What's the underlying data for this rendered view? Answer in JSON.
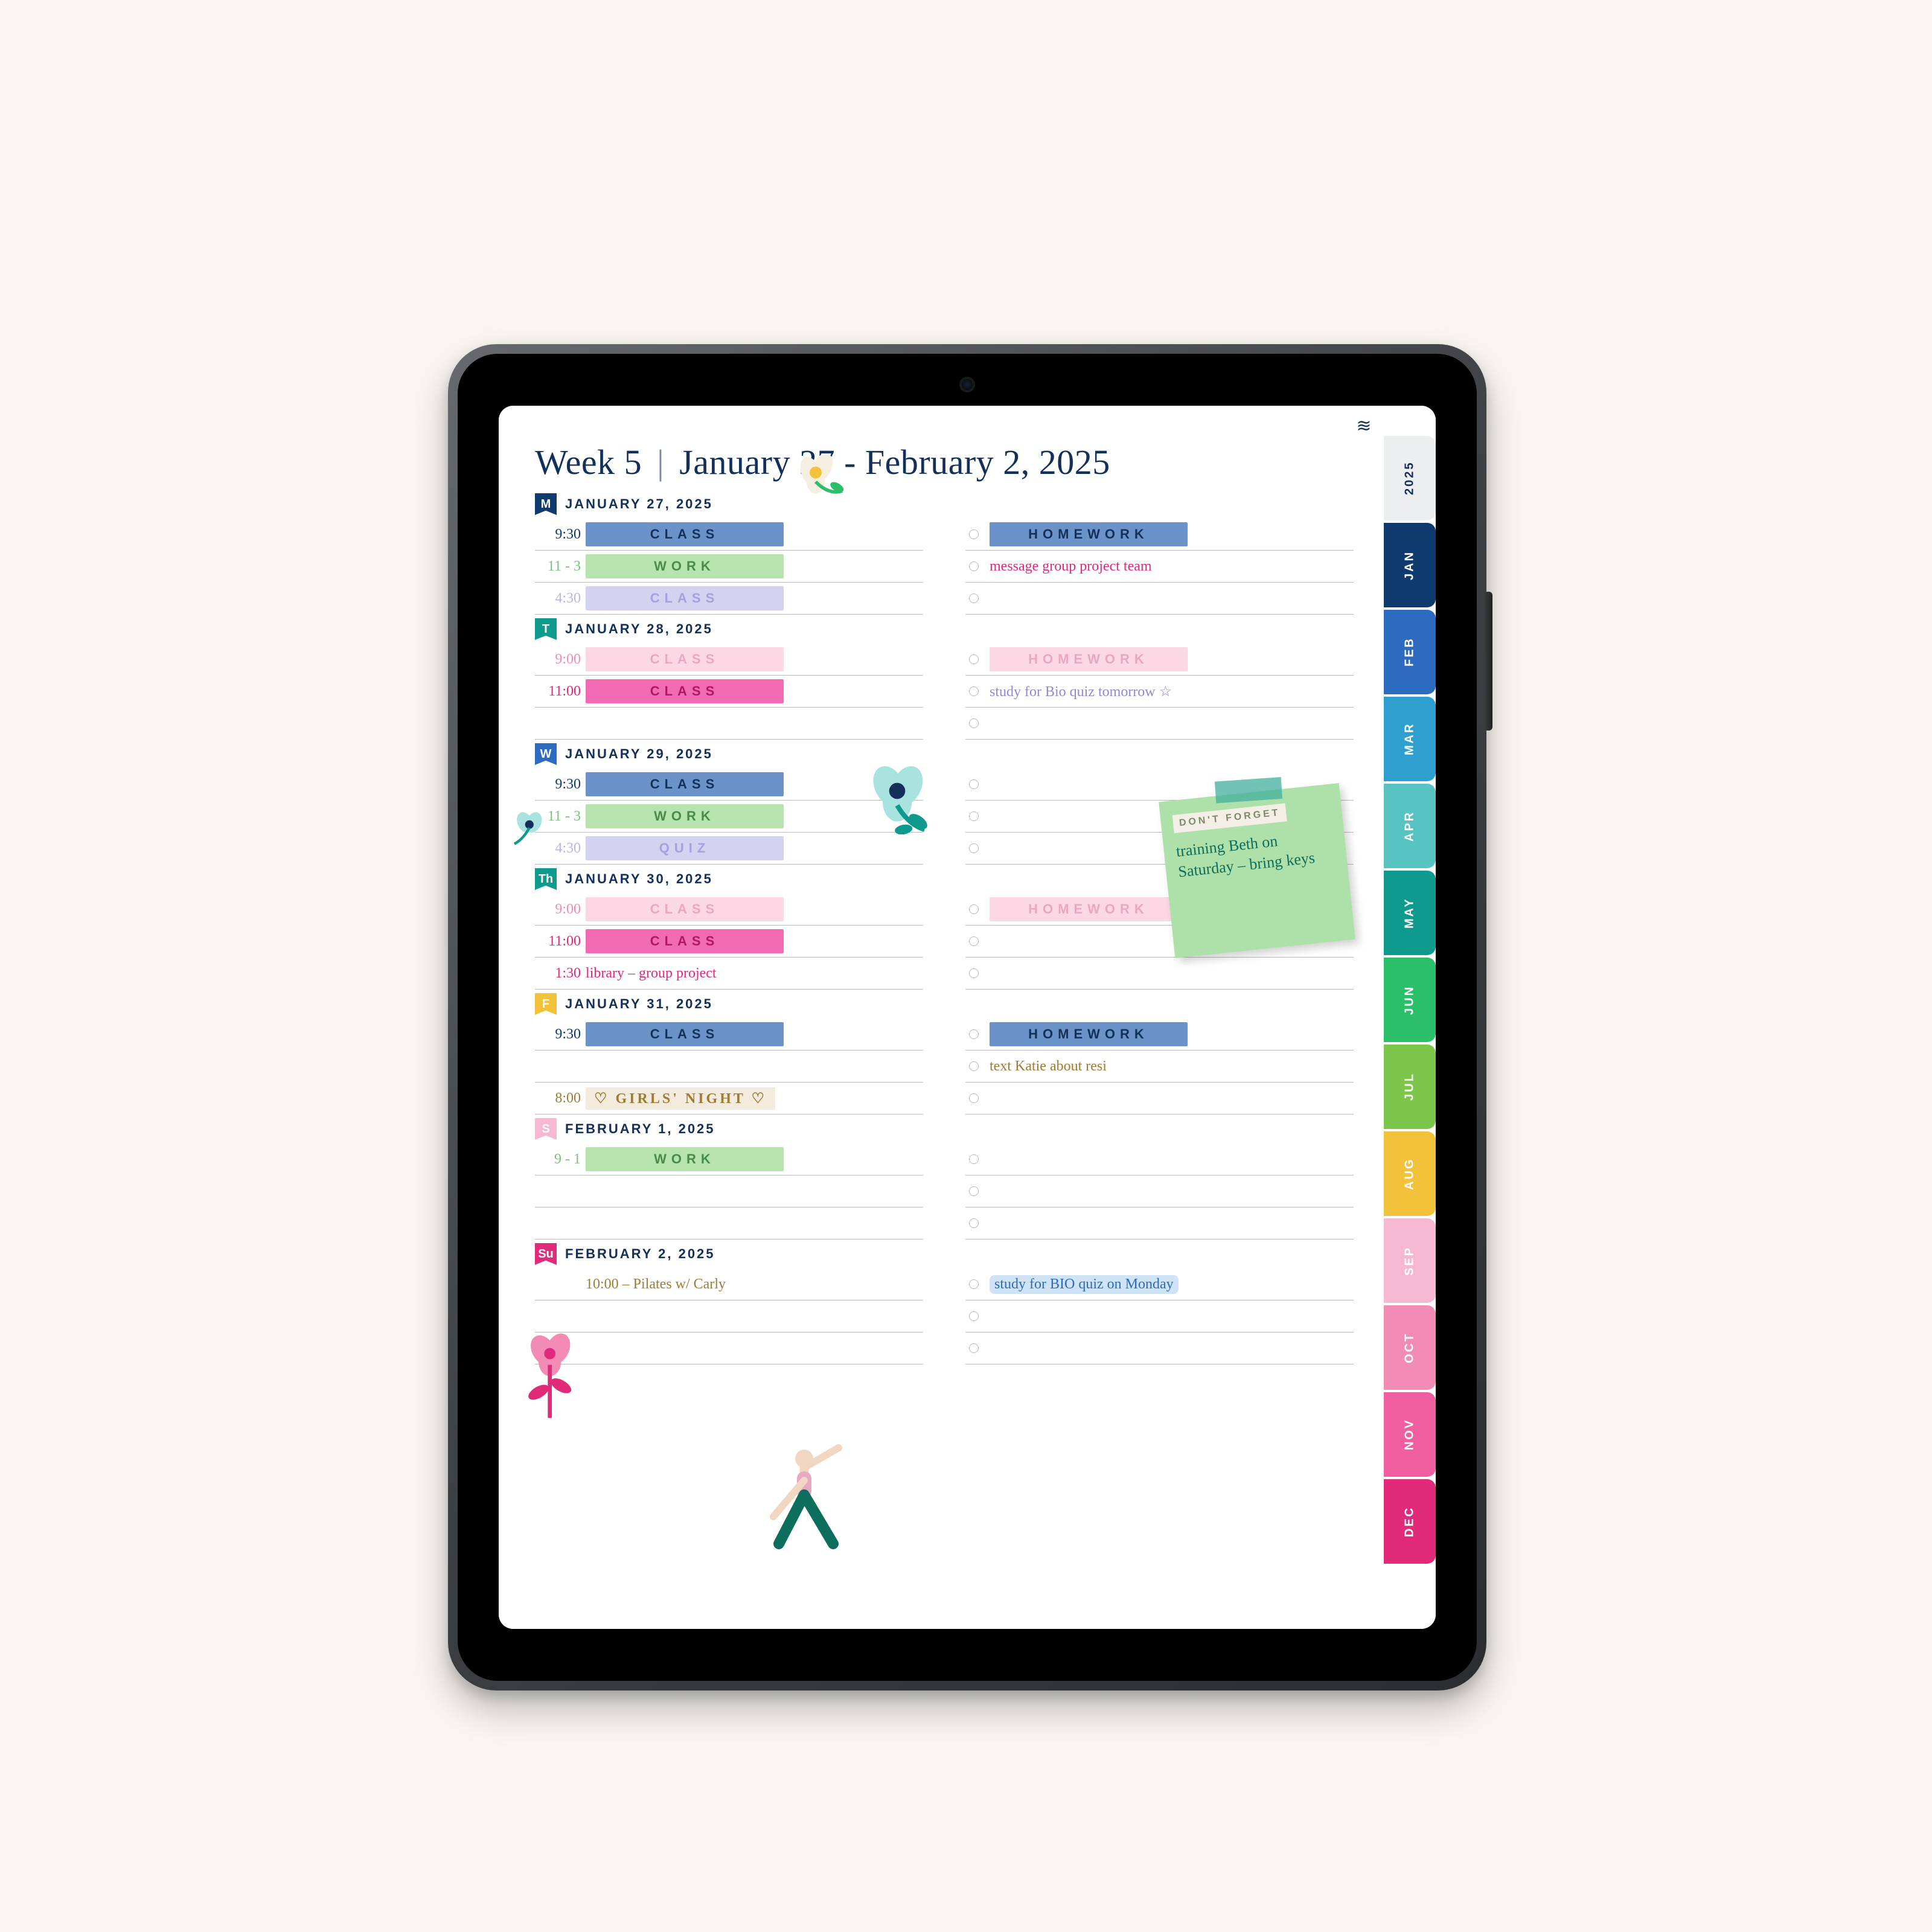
{
  "header": {
    "week": "Week 5",
    "range": "January 27 - February 2, 2025"
  },
  "brand_icon": "≋",
  "tabs": {
    "year": "2025",
    "months": [
      {
        "label": "JAN",
        "bg": "#0f3a6e"
      },
      {
        "label": "FEB",
        "bg": "#2c6bbf"
      },
      {
        "label": "MAR",
        "bg": "#2f9fcf"
      },
      {
        "label": "APR",
        "bg": "#58c4c2"
      },
      {
        "label": "MAY",
        "bg": "#0e9a8c"
      },
      {
        "label": "JUN",
        "bg": "#2bbf6a"
      },
      {
        "label": "JUL",
        "bg": "#7cc64b"
      },
      {
        "label": "AUG",
        "bg": "#f2c23a"
      },
      {
        "label": "SEP",
        "bg": "#f6b8d1"
      },
      {
        "label": "OCT",
        "bg": "#f28bb5"
      },
      {
        "label": "NOV",
        "bg": "#ef5fa0"
      },
      {
        "label": "DEC",
        "bg": "#e22a7a"
      }
    ]
  },
  "sticky": {
    "label": "DON'T FORGET",
    "note": "training Beth on Saturday – bring keys"
  },
  "days": [
    {
      "code": "M",
      "flag_bg": "#0f3a6e",
      "date": "JANUARY 27, 2025",
      "left": [
        {
          "time": "9:30",
          "time_color": "#0f3a6e",
          "label": "CLASS",
          "bg": "#6c93c9",
          "fg": "#13305b"
        },
        {
          "time": "11 - 3",
          "time_color": "#7fbf7f",
          "label": "WORK",
          "bg": "#b7e3af",
          "fg": "#4a8a4a"
        },
        {
          "time": "4:30",
          "time_color": "#b8b6e6",
          "label": "CLASS",
          "bg": "#d3d2f1",
          "fg": "#a3a1df"
        }
      ],
      "right": [
        {
          "type": "block",
          "label": "HOMEWORK",
          "bg": "#6c93c9",
          "fg": "#13305b"
        },
        {
          "type": "text",
          "text": "message group project team",
          "color": "#e22a7a"
        },
        {
          "type": "empty"
        }
      ]
    },
    {
      "code": "T",
      "flag_bg": "#0e9a8c",
      "date": "JANUARY 28, 2025",
      "left": [
        {
          "time": "9:00",
          "time_color": "#f28bb5",
          "label": "CLASS",
          "bg": "#fbd8e4",
          "fg": "#e9a8c2"
        },
        {
          "time": "11:00",
          "time_color": "#e22a7a",
          "label": "CLASS",
          "bg": "#f06bb4",
          "fg": "#b01766"
        },
        {
          "time": "",
          "label": "",
          "bg": "",
          "fg": ""
        }
      ],
      "right": [
        {
          "type": "block",
          "label": "HOMEWORK",
          "bg": "#fbd8e4",
          "fg": "#e9a8c2"
        },
        {
          "type": "text",
          "text": "study for Bio quiz tomorrow ☆",
          "color": "#8d8ad6"
        },
        {
          "type": "empty"
        }
      ]
    },
    {
      "code": "W",
      "flag_bg": "#2c6bbf",
      "date": "JANUARY 29, 2025",
      "left": [
        {
          "time": "9:30",
          "time_color": "#0f3a6e",
          "label": "CLASS",
          "bg": "#6c93c9",
          "fg": "#13305b"
        },
        {
          "time": "11 - 3",
          "time_color": "#7fbf7f",
          "label": "WORK",
          "bg": "#b7e3af",
          "fg": "#4a8a4a"
        },
        {
          "time": "4:30",
          "time_color": "#b8b6e6",
          "label": "QUIZ",
          "bg": "#d3d2f1",
          "fg": "#a3a1df"
        }
      ],
      "right": [
        {
          "type": "empty"
        },
        {
          "type": "empty"
        },
        {
          "type": "empty"
        }
      ]
    },
    {
      "code": "Th",
      "flag_bg": "#0e9a8c",
      "date": "JANUARY 30, 2025",
      "left": [
        {
          "time": "9:00",
          "time_color": "#f28bb5",
          "label": "CLASS",
          "bg": "#fbd8e4",
          "fg": "#e9a8c2"
        },
        {
          "time": "11:00",
          "time_color": "#e22a7a",
          "label": "CLASS",
          "bg": "#f06bb4",
          "fg": "#b01766"
        },
        {
          "time": "1:30",
          "time_color": "#e22a7a",
          "hand": "library – group project",
          "hand_color": "#e22a7a"
        }
      ],
      "right": [
        {
          "type": "block",
          "label": "HOMEWORK",
          "bg": "#fbd8e4",
          "fg": "#e9a8c2"
        },
        {
          "type": "empty"
        },
        {
          "type": "empty"
        }
      ]
    },
    {
      "code": "F",
      "flag_bg": "#f2c23a",
      "date": "JANUARY 31, 2025",
      "left": [
        {
          "time": "9:30",
          "time_color": "#0f3a6e",
          "label": "CLASS",
          "bg": "#6c93c9",
          "fg": "#13305b"
        },
        {
          "time": "",
          "label": "",
          "bg": "",
          "fg": ""
        },
        {
          "time": "8:00",
          "time_color": "#a07b34",
          "hand": "♡ GIRLS' NIGHT ♡",
          "hand_color": "#a07b34",
          "hand_bg": "#f3ecde"
        }
      ],
      "right": [
        {
          "type": "block",
          "label": "HOMEWORK",
          "bg": "#6c93c9",
          "fg": "#13305b"
        },
        {
          "type": "text",
          "text": "text Katie about resi",
          "color": "#a07b34"
        },
        {
          "type": "empty"
        }
      ]
    },
    {
      "code": "S",
      "flag_bg": "#f6b8d1",
      "date": "FEBRUARY 1, 2025",
      "left": [
        {
          "time": "9 - 1",
          "time_color": "#7fbf7f",
          "label": "WORK",
          "bg": "#b7e3af",
          "fg": "#4a8a4a"
        },
        {
          "time": "",
          "label": "",
          "bg": "",
          "fg": ""
        },
        {
          "time": "",
          "label": "",
          "bg": "",
          "fg": ""
        }
      ],
      "right": [
        {
          "type": "empty"
        },
        {
          "type": "empty"
        },
        {
          "type": "empty"
        }
      ]
    },
    {
      "code": "Su",
      "flag_bg": "#e22a7a",
      "date": "FEBRUARY 2, 2025",
      "left": [
        {
          "time": "",
          "hand": "10:00 – Pilates w/ Carly",
          "hand_color": "#a07b34"
        },
        {
          "time": "",
          "label": "",
          "bg": "",
          "fg": ""
        },
        {
          "time": "",
          "label": "",
          "bg": "",
          "fg": ""
        }
      ],
      "right": [
        {
          "type": "text",
          "text": "study for BIO quiz on Monday",
          "color": "#2c6bbf",
          "hl": "#cfe3f7"
        },
        {
          "type": "empty"
        },
        {
          "type": "empty"
        }
      ]
    }
  ]
}
